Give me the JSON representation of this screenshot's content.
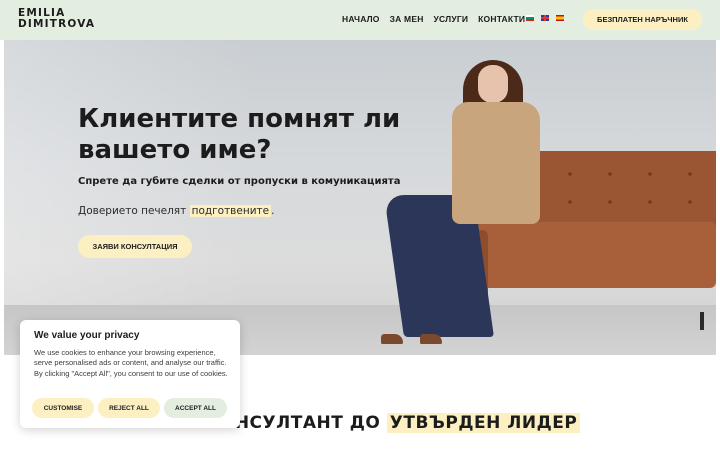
{
  "header": {
    "logo_line1": "EMILIA",
    "logo_line2": "DIMITROVA",
    "nav": [
      "НАЧАЛО",
      "ЗА МЕН",
      "УСЛУГИ",
      "КОНТАКТИ"
    ],
    "languages": [
      "bg",
      "en",
      "es"
    ],
    "cta": "БЕЗПЛАТЕН НАРЪЧНИК"
  },
  "hero": {
    "title": "Клиентите помнят ли вашето име?",
    "subtitle": "Спрете да губите сделки от пропуски в комуникацията",
    "trust_prefix": "Доверието печелят ",
    "trust_highlight": "подготвените",
    "trust_suffix": ".",
    "button": "ЗАЯВИ КОНСУЛТАЦИЯ"
  },
  "section": {
    "title_prefix": "ОТ КОНСУЛТАНТ ДО ",
    "title_highlight": "УТВЪРДЕН ЛИДЕР"
  },
  "cookie": {
    "title": "We value your privacy",
    "text": "We use cookies to enhance your browsing experience, serve personalised ads or content, and analyse our traffic. By clicking \"Accept All\", you consent to our use of cookies.",
    "customise": "CUSTOMISE",
    "reject": "REJECT ALL",
    "accept": "ACCEPT ALL"
  },
  "colors": {
    "header_bg": "#e3eee1",
    "accent_yellow": "#fcf0c3",
    "text": "#1c1c1c"
  }
}
